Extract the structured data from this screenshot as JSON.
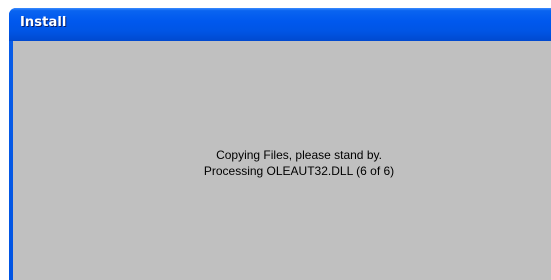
{
  "window": {
    "title": "Install"
  },
  "status": {
    "line1": "Copying Files, please stand by.",
    "line2": "Processing OLEAUT32.DLL (6 of 6)"
  },
  "colors": {
    "titlebar": "#0055e5",
    "client_background": "#c0c0c0"
  }
}
